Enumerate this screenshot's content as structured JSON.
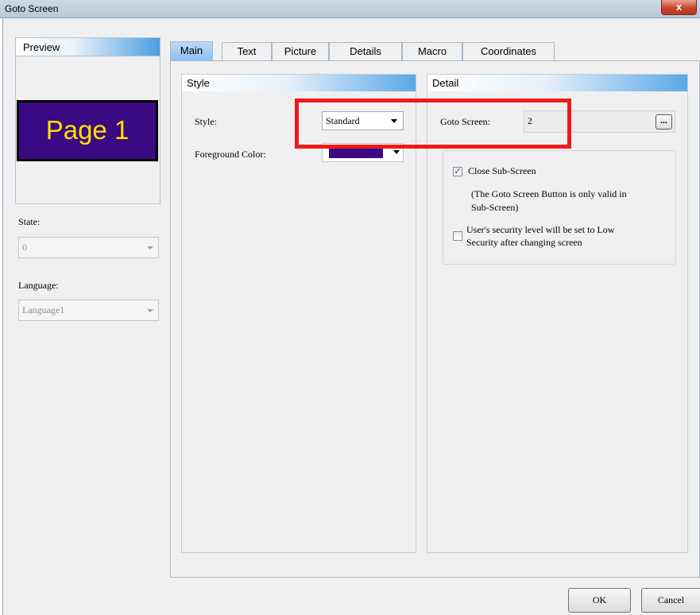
{
  "window": {
    "title": "Goto Screen",
    "close_glyph": "x"
  },
  "preview": {
    "label": "Preview",
    "button_text": "Page 1",
    "button_bg": "#3a0a82",
    "button_fg": "#ffe100"
  },
  "state": {
    "label": "State:",
    "value": "0"
  },
  "language": {
    "label": "Language:",
    "value": "Language1"
  },
  "tabs": [
    {
      "label": "Main",
      "active": true
    },
    {
      "label": "Text"
    },
    {
      "label": "Picture"
    },
    {
      "label": "Details"
    },
    {
      "label": "Macro"
    },
    {
      "label": "Coordinates"
    }
  ],
  "style_group": {
    "header": "Style",
    "style_label": "Style:",
    "style_value": "Standard",
    "fg_label": "Foreground Color:",
    "fg_color": "#3a0a82"
  },
  "detail_group": {
    "header": "Detail",
    "goto_label": "Goto Screen:",
    "goto_value": "2",
    "browse_label": "...",
    "close_sub_label": "Close Sub-Screen",
    "close_sub_checked": true,
    "note_line1": "(The Goto Screen Button is only valid in",
    "note_line2": "Sub-Screen)",
    "security_line1": "User's security level will be set to Low",
    "security_line2": "Security after changing screen",
    "security_checked": false
  },
  "buttons": {
    "ok": "OK",
    "cancel": "Cancel"
  },
  "annotation_color": "#ee1b1b"
}
